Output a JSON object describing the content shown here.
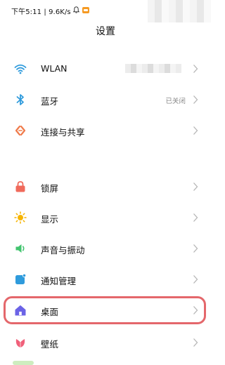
{
  "status_bar": {
    "text": "下午5:11 | 9.6K/s",
    "icons": [
      "bell-icon",
      "app-badge-icon"
    ]
  },
  "title": "设置",
  "rows": [
    {
      "label": "WLAN",
      "value": "",
      "icon": "wifi-icon",
      "icon_color": "#2f9bdc"
    },
    {
      "label": "蓝牙",
      "value": "已关闭",
      "icon": "bluetooth-icon",
      "icon_color": "#2f9bdc"
    },
    {
      "label": "连接与共享",
      "value": "",
      "icon": "share-link-icon",
      "icon_color": "#f07a4a"
    },
    {
      "label": "锁屏",
      "value": "",
      "icon": "lock-icon",
      "icon_color": "#f06a5b"
    },
    {
      "label": "显示",
      "value": "",
      "icon": "sun-icon",
      "icon_color": "#f6b400"
    },
    {
      "label": "声音与振动",
      "value": "",
      "icon": "sound-icon",
      "icon_color": "#42c46f"
    },
    {
      "label": "通知管理",
      "value": "",
      "icon": "notification-icon",
      "icon_color": "#2f9bdc"
    },
    {
      "label": "桌面",
      "value": "",
      "icon": "home-icon",
      "icon_color": "#6b63e6"
    },
    {
      "label": "壁纸",
      "value": "",
      "icon": "wallpaper-icon",
      "icon_color": "#f0607a"
    }
  ],
  "highlight_color": "#e4676b",
  "chevron": "chevron-right-icon"
}
